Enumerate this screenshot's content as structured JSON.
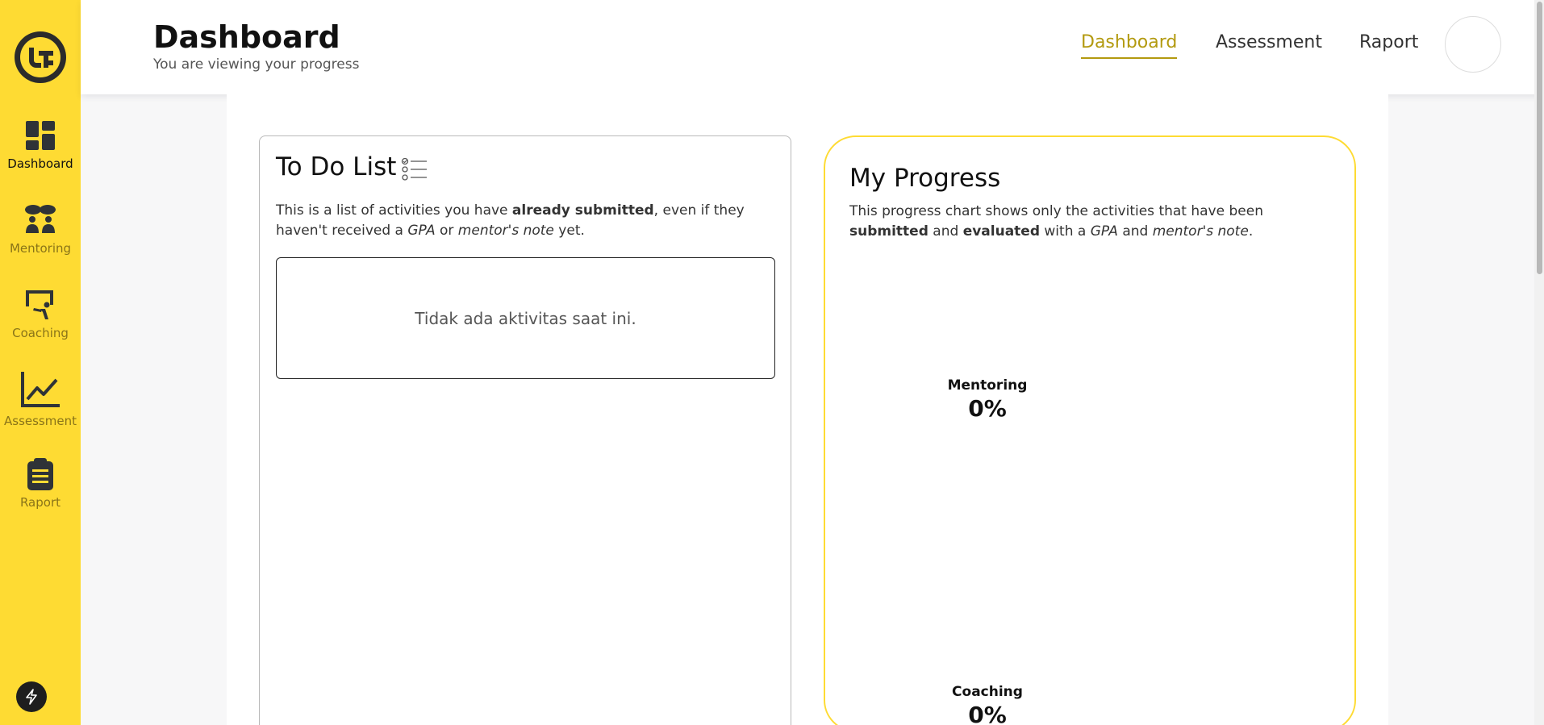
{
  "sidebar": {
    "items": [
      {
        "label": "Dashboard",
        "icon": "dashboard-icon",
        "active": true
      },
      {
        "label": "Mentoring",
        "icon": "mentoring-icon",
        "active": false
      },
      {
        "label": "Coaching",
        "icon": "coaching-icon",
        "active": false
      },
      {
        "label": "Assessment",
        "icon": "chart-line-icon",
        "active": false
      },
      {
        "label": "Raport",
        "icon": "clipboard-icon",
        "active": false
      }
    ],
    "accent_color": "#fedb33"
  },
  "header": {
    "title": "Dashboard",
    "subtitle": "You are viewing your progress",
    "nav": [
      {
        "label": "Dashboard",
        "active": true
      },
      {
        "label": "Assessment",
        "active": false
      },
      {
        "label": "Raport",
        "active": false
      }
    ],
    "active_color": "#b39a10"
  },
  "todo": {
    "title": "To Do List",
    "desc_1": "This is a list of activities you have ",
    "desc_bold": "already submitted",
    "desc_2": ", even if they haven't received a ",
    "desc_gpa": "GPA",
    "desc_3": " or ",
    "desc_note": "mentor's note",
    "desc_4": " yet.",
    "empty_text": "Tidak ada aktivitas saat ini."
  },
  "progress": {
    "title": "My Progress",
    "desc_1": "This progress chart shows only the activities that have been ",
    "desc_submitted": "submitted",
    "desc_2": " and ",
    "desc_evaluated": "evaluated",
    "desc_3": " with a ",
    "desc_gpa": "GPA",
    "desc_4": " and ",
    "desc_note": "mentor's note",
    "desc_5": ".",
    "metrics": [
      {
        "label": "Mentoring",
        "value": "0%"
      },
      {
        "label": "Coaching",
        "value": "0%"
      }
    ]
  }
}
